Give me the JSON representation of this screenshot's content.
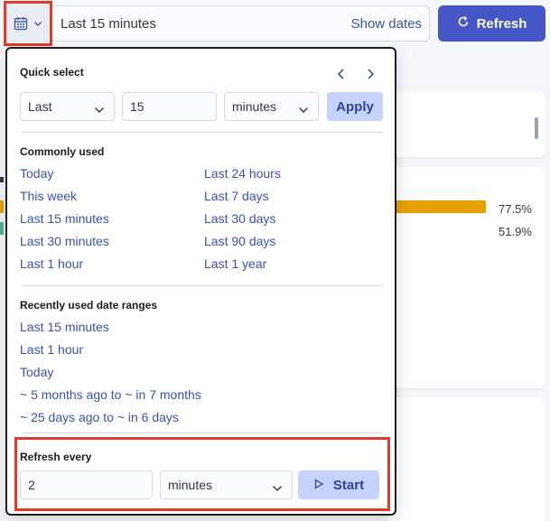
{
  "topbar": {
    "range_label": "Last 15 minutes",
    "show_dates": "Show dates",
    "refresh_label": "Refresh"
  },
  "background": {
    "pct1": "77.5%",
    "pct2": "51.9%"
  },
  "quick_select": {
    "title": "Quick select",
    "direction": "Last",
    "value": "15",
    "unit": "minutes",
    "apply_label": "Apply"
  },
  "commonly_used": {
    "title": "Commonly used",
    "left": [
      "Today",
      "This week",
      "Last 15 minutes",
      "Last 30 minutes",
      "Last 1 hour"
    ],
    "right": [
      "Last 24 hours",
      "Last 7 days",
      "Last 30 days",
      "Last 90 days",
      "Last 1 year"
    ]
  },
  "recently_used": {
    "title": "Recently used date ranges",
    "items": [
      "Last 15 minutes",
      "Last 1 hour",
      "Today",
      "~ 5 months ago to ~ in 7 months",
      "~ 25 days ago to ~ in 6 days"
    ]
  },
  "refresh_every": {
    "title": "Refresh every",
    "value": "2",
    "unit": "minutes",
    "start_label": "Start"
  },
  "colors": {
    "accent": "#4556c7",
    "link": "#3a53a9",
    "highlight": "#e03b2b"
  }
}
